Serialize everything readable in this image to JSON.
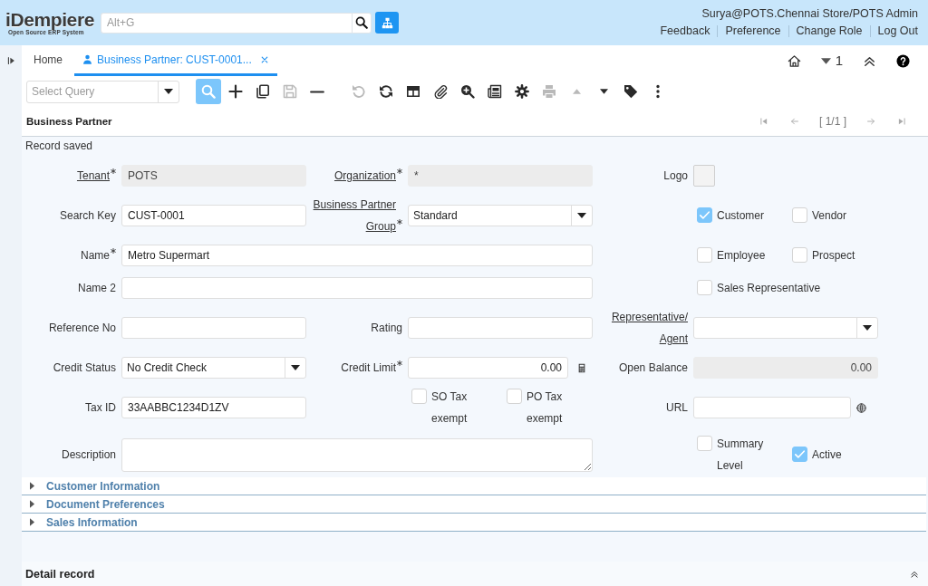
{
  "header": {
    "logo": {
      "wordmark": "iDempiere",
      "tagline": "Open Source ERP System"
    },
    "search": {
      "placeholder": "Alt+G"
    },
    "user": "Surya@POTS.Chennai Store/POTS Admin",
    "links": [
      "Feedback",
      "Preference",
      "Change Role",
      "Log Out"
    ]
  },
  "tabs": [
    {
      "kind": "home",
      "label": "Home",
      "selected": false
    },
    {
      "kind": "window",
      "label": "Business Partner: CUST-0001...",
      "selected": true
    }
  ],
  "open_windows": "1",
  "toolbar": {
    "query": {
      "placeholder": "Select Query"
    },
    "button_groups": [
      {
        "buttons": [
          {
            "kind": "find",
            "pressed": true,
            "disabled": false
          },
          {
            "kind": "new",
            "pressed": false,
            "disabled": false
          },
          {
            "kind": "copy",
            "pressed": false,
            "disabled": false
          },
          {
            "kind": "save",
            "pressed": false,
            "disabled": true
          },
          {
            "kind": "delete",
            "pressed": false,
            "disabled": false
          }
        ]
      },
      {
        "buttons": [
          {
            "kind": "undo",
            "pressed": false,
            "disabled": true
          },
          {
            "kind": "refresh",
            "pressed": false,
            "disabled": false
          },
          {
            "kind": "grid",
            "pressed": false,
            "disabled": false
          },
          {
            "kind": "attachment",
            "pressed": false,
            "disabled": false
          },
          {
            "kind": "zoom",
            "pressed": false,
            "disabled": false
          },
          {
            "kind": "report",
            "pressed": false,
            "disabled": false
          },
          {
            "kind": "settings",
            "pressed": false,
            "disabled": false
          },
          {
            "kind": "print",
            "pressed": false,
            "disabled": true
          },
          {
            "kind": "previous",
            "pressed": false,
            "disabled": true
          },
          {
            "kind": "next",
            "pressed": false,
            "disabled": false
          },
          {
            "kind": "tag",
            "pressed": false,
            "disabled": false
          },
          {
            "kind": "more",
            "pressed": false,
            "disabled": false
          }
        ]
      }
    ]
  },
  "panel": {
    "title": "Business Partner",
    "navigation": {
      "before": [
        {
          "kind": "first",
          "disabled": true
        },
        {
          "kind": "previous",
          "disabled": true
        }
      ],
      "counter": "[ 1/1 ]",
      "after": [
        {
          "kind": "next",
          "disabled": true
        },
        {
          "kind": "last",
          "disabled": true
        }
      ]
    }
  },
  "status": "Record saved",
  "form": {
    "rows": [
      {
        "cells": [
          {
            "kind": "text",
            "label": "Tenant",
            "mandatory": true,
            "link": true,
            "readonly": true,
            "value": "POTS"
          },
          {
            "kind": "text",
            "label": "Organization",
            "mandatory": true,
            "link": true,
            "readonly": true,
            "value": "*"
          },
          {
            "kind": "image",
            "label": "Logo",
            "mandatory": false,
            "link": false
          }
        ]
      },
      {
        "cells": [
          {
            "kind": "text",
            "label": "Search Key",
            "mandatory": false,
            "link": false,
            "readonly": false,
            "value": "CUST-0001"
          },
          {
            "kind": "select",
            "label": "Business Partner Group",
            "mandatory": true,
            "link": true,
            "readonly": false,
            "value": "Standard"
          },
          {
            "kind": "checks",
            "items": [
              {
                "label": "Customer",
                "checked": true
              },
              {
                "label": "Vendor",
                "checked": false
              }
            ]
          }
        ]
      },
      {
        "cells": [
          {
            "kind": "wide-text",
            "label": "Name",
            "mandatory": true,
            "link": false,
            "readonly": false,
            "value": "Metro Supermart"
          },
          {
            "kind": "checks",
            "items": [
              {
                "label": "Employee",
                "checked": false
              },
              {
                "label": "Prospect",
                "checked": false
              }
            ]
          }
        ]
      },
      {
        "cells": [
          {
            "kind": "wide-text",
            "label": "Name 2",
            "mandatory": false,
            "link": false,
            "readonly": false
          },
          {
            "kind": "checks",
            "items": [
              {
                "label": "Sales Representative",
                "checked": false
              }
            ]
          }
        ]
      },
      {
        "cells": [
          {
            "kind": "text",
            "label": "Reference No",
            "mandatory": false,
            "link": false,
            "readonly": false
          },
          {
            "kind": "text",
            "label": "Rating",
            "mandatory": false,
            "link": false,
            "readonly": false
          },
          {
            "kind": "select",
            "label": "Representative/Agent",
            "mandatory": false,
            "link": true,
            "readonly": false
          }
        ]
      },
      {
        "cells": [
          {
            "kind": "select",
            "label": "Credit Status",
            "mandatory": false,
            "link": false,
            "readonly": false,
            "value": "No Credit Check"
          },
          {
            "kind": "amount",
            "label": "Credit Limit",
            "mandatory": true,
            "link": false,
            "readonly": false,
            "value": "0.00"
          },
          {
            "kind": "amount",
            "label": "Open Balance",
            "mandatory": false,
            "link": false,
            "readonly": true,
            "value": "0.00"
          }
        ]
      },
      {
        "cells": [
          {
            "kind": "text",
            "label": "Tax ID",
            "mandatory": false,
            "link": false,
            "readonly": false,
            "value": "33AABBC1234D1ZV"
          },
          {
            "kind": "checks",
            "items": [
              {
                "label": "SO Tax exempt",
                "checked": false
              },
              {
                "label": "PO Tax exempt",
                "checked": false
              }
            ]
          },
          {
            "kind": "url",
            "label": "URL",
            "mandatory": false,
            "link": false,
            "readonly": false
          }
        ]
      },
      {
        "cells": [
          {
            "kind": "textarea",
            "label": "Description",
            "mandatory": false,
            "link": false,
            "readonly": false
          },
          {
            "kind": "checks",
            "items": [
              {
                "label": "Summary Level",
                "checked": false
              },
              {
                "label": "Active",
                "checked": true
              }
            ]
          }
        ]
      }
    ]
  },
  "sections": [
    {
      "title": "Customer Information",
      "expanded": false
    },
    {
      "title": "Document Preferences",
      "expanded": false
    },
    {
      "title": "Sales Information",
      "expanded": false
    }
  ],
  "detail": {
    "title": "Detail record"
  }
}
